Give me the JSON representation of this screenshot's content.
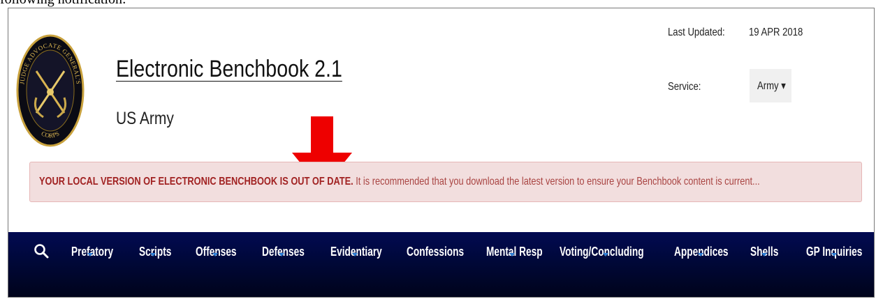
{
  "caption": "following notification:",
  "header": {
    "logo_text": {
      "top": "JUDGE ADVOCATE GENERAL'S",
      "bottom": "CORPS"
    },
    "title": "Electronic Benchbook 2.1",
    "subtitle": "US Army"
  },
  "meta": {
    "last_updated_label": "Last Updated:",
    "last_updated_value": "19 APR 2018",
    "service_label": "Service:",
    "service_value": "Army ▾"
  },
  "alert": {
    "strong": "YOUR LOCAL VERSION OF ELECTRONIC BENCHBOOK IS OUT OF DATE.",
    "body": " It is recommended that you download the latest version to ensure your Benchbook content is current..."
  },
  "nav": {
    "items": [
      {
        "label": "Prefatory"
      },
      {
        "label": "Scripts"
      },
      {
        "label": "Offenses"
      },
      {
        "label": "Defenses"
      },
      {
        "label": "Evidentiary"
      },
      {
        "label": "Confessions"
      },
      {
        "label": "Mental Resp"
      },
      {
        "label": "Voting/Concluding"
      },
      {
        "label": "Appendices"
      },
      {
        "label": "Shells"
      },
      {
        "label": "GP Inquiries"
      }
    ]
  },
  "colors": {
    "alert_bg": "#f2dede",
    "alert_text": "#a94442",
    "nav_bg": "#000838",
    "caret": "#2f7fd6",
    "arrow": "#ee0000"
  },
  "icons": [
    "search-icon",
    "chevron-down-icon",
    "down-arrow-annotation",
    "jag-corps-logo"
  ]
}
